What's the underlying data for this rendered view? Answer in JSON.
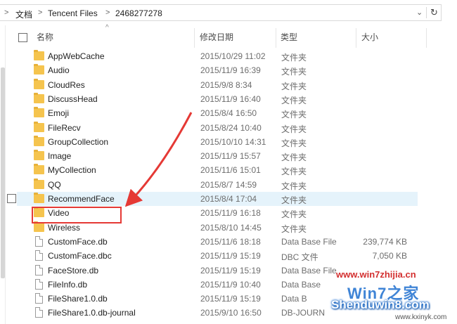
{
  "address": {
    "crumbs": [
      "文档",
      "Tencent Files",
      "2468277278"
    ],
    "separator": ">",
    "dropdown_glyph": "⌄",
    "refresh_glyph": "↻"
  },
  "columns": {
    "name": "名称",
    "date": "修改日期",
    "type": "类型",
    "size": "大小",
    "sort_glyph": "^"
  },
  "rows": [
    {
      "name": "AppWebCache",
      "date": "2015/10/29 11:02",
      "type": "文件夹",
      "size": "",
      "icon": "folder-icon"
    },
    {
      "name": "Audio",
      "date": "2015/11/9 16:39",
      "type": "文件夹",
      "size": "",
      "icon": "folder-icon"
    },
    {
      "name": "CloudRes",
      "date": "2015/9/8 8:34",
      "type": "文件夹",
      "size": "",
      "icon": "folder-icon"
    },
    {
      "name": "DiscussHead",
      "date": "2015/11/9 16:40",
      "type": "文件夹",
      "size": "",
      "icon": "folder-icon"
    },
    {
      "name": "Emoji",
      "date": "2015/8/4 16:50",
      "type": "文件夹",
      "size": "",
      "icon": "folder-icon"
    },
    {
      "name": "FileRecv",
      "date": "2015/8/24 10:40",
      "type": "文件夹",
      "size": "",
      "icon": "folder-icon"
    },
    {
      "name": "GroupCollection",
      "date": "2015/10/10 14:31",
      "type": "文件夹",
      "size": "",
      "icon": "folder-icon"
    },
    {
      "name": "Image",
      "date": "2015/11/9 15:57",
      "type": "文件夹",
      "size": "",
      "icon": "folder-icon"
    },
    {
      "name": "MyCollection",
      "date": "2015/11/6 15:01",
      "type": "文件夹",
      "size": "",
      "icon": "folder-icon"
    },
    {
      "name": "QQ",
      "date": "2015/8/7 14:59",
      "type": "文件夹",
      "size": "",
      "icon": "folder-icon"
    },
    {
      "name": "RecommendFace",
      "date": "2015/8/4 17:04",
      "type": "文件夹",
      "size": "",
      "icon": "folder-icon"
    },
    {
      "name": "Video",
      "date": "2015/11/9 16:18",
      "type": "文件夹",
      "size": "",
      "icon": "folder-icon"
    },
    {
      "name": "Wireless",
      "date": "2015/8/10 14:45",
      "type": "文件夹",
      "size": "",
      "icon": "folder-icon"
    },
    {
      "name": "CustomFace.db",
      "date": "2015/11/6 18:18",
      "type": "Data Base File",
      "size": "239,774 KB",
      "icon": "file-icon"
    },
    {
      "name": "CustomFace.dbc",
      "date": "2015/11/9 15:19",
      "type": "DBC 文件",
      "size": "7,050 KB",
      "icon": "file-icon"
    },
    {
      "name": "FaceStore.db",
      "date": "2015/11/9 15:19",
      "type": "Data Base File",
      "size": "",
      "icon": "file-icon"
    },
    {
      "name": "FileInfo.db",
      "date": "2015/11/9 10:40",
      "type": "Data Base",
      "size": "",
      "icon": "file-icon"
    },
    {
      "name": "FileShare1.0.db",
      "date": "2015/11/9 15:19",
      "type": "Data B",
      "size": "",
      "icon": "file-icon"
    },
    {
      "name": "FileShare1.0.db-journal",
      "date": "2015/9/10 16:50",
      "type": "DB-JOURN",
      "size": "",
      "icon": "file-icon"
    }
  ],
  "highlight": {
    "hover_row": "RecommendFace",
    "annotated_row": "Video",
    "annotation_color": "#e53935"
  },
  "watermark": {
    "url": "www.win7zhijia.cn",
    "logo": "Win7之家",
    "brand": "Shenduwin8.com",
    "site": "www.kxinyk.com"
  }
}
